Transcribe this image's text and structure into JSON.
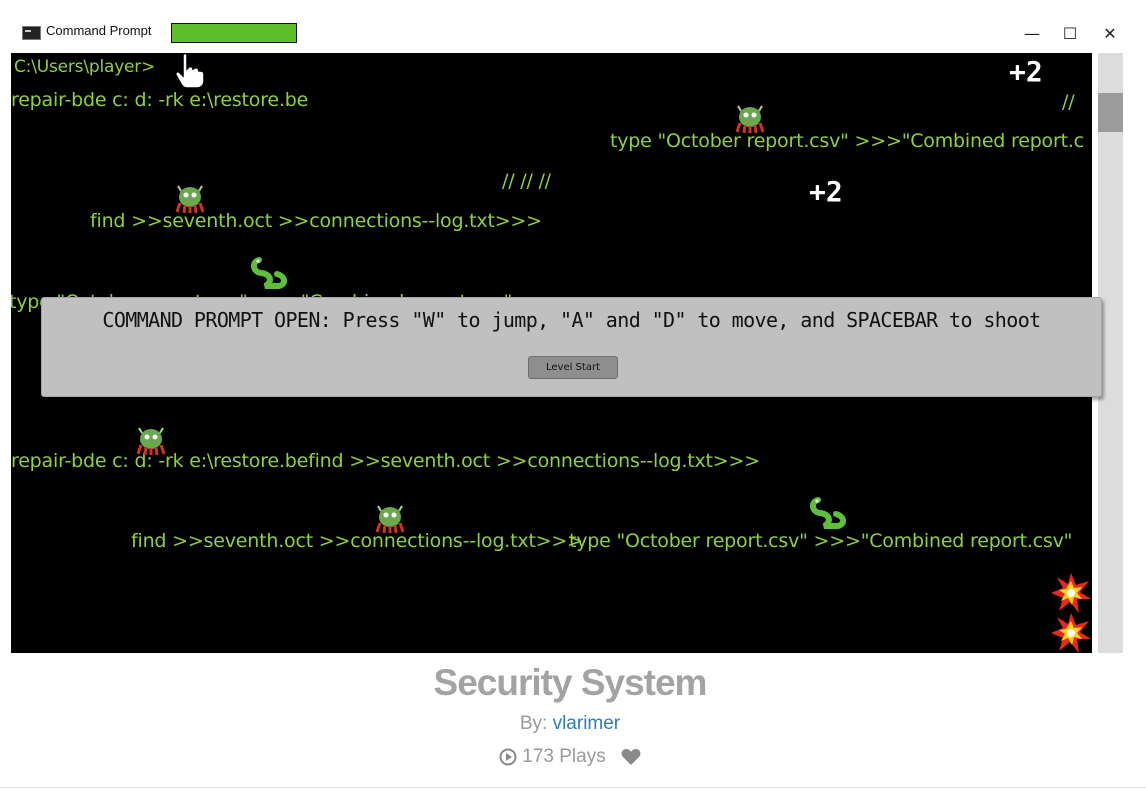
{
  "window": {
    "title": "Command Prompt",
    "health_fraction": 1.0,
    "minimize_glyph": "—",
    "maximize_glyph": "☐",
    "close_glyph": "✕"
  },
  "game": {
    "prompt": "C:\\Users\\player>",
    "lines": [
      "repair-bde c: d: -rk e:\\restore.be",
      "type \"October report.csv\" >>>\"Combined report.c",
      "//    //    //",
      "find >>seventh.oct >>connections--log.txt>>>",
      "type \"October report.csv\" >>>\"Combined report.csv\"",
      "repair-bde c: d: -rk e:\\restore.befind >>seventh.oct >>connections--log.txt>>>",
      "find >>seventh.oct >>connections--log.txt>>>",
      "type \"October report.csv\" >>>\"Combined report.csv\"",
      "//"
    ],
    "score_popups": [
      "+2",
      "+2"
    ],
    "dialog": {
      "message": "COMMAND PROMPT OPEN: Press \"W\" to jump, \"A\" and \"D\" to move, and SPACEBAR to shoot",
      "button_label": "Level Start"
    }
  },
  "footer": {
    "title": "Security System",
    "by_label": "By:",
    "author": "vlarimer",
    "plays": "173 Plays"
  },
  "colors": {
    "terminal_text": "#8fd13a",
    "health_bar": "#5cbf2a",
    "author_link": "#2a7dbe"
  }
}
